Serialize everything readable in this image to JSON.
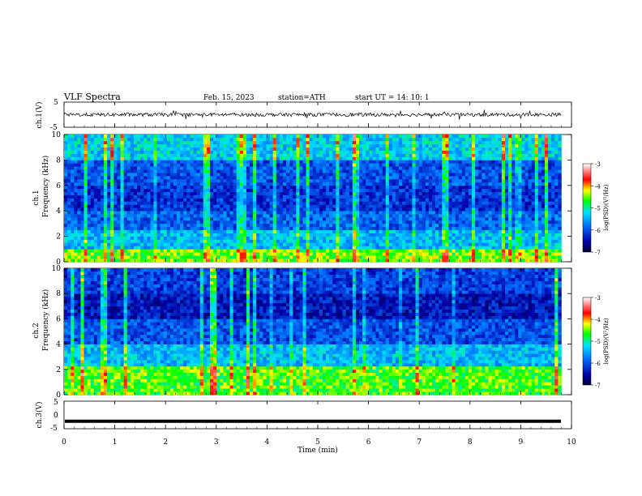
{
  "header": {
    "title": "VLF  Spectra",
    "date": "Feb. 15, 2023",
    "station": "station=ATH",
    "start": "start  UT  =    14: 10: 1"
  },
  "colors": {
    "background": "#ffffff",
    "axis": "#000000",
    "spectrogram_low": "#00007f",
    "spectrogram_mid": "#1e78ff",
    "spectrogram_high": "#00ff00",
    "spectrogram_peak": "#ff6600"
  },
  "chart_data": [
    {
      "type": "line",
      "name": "ch1-waveform",
      "ylabel": "ch.1(V)",
      "ylim": [
        -5,
        5
      ],
      "yticks": [
        "5",
        "-5"
      ],
      "xlim": [
        0,
        10
      ],
      "trace": "noisy waveform around 0 V with small excursions",
      "trace_level": 0
    },
    {
      "type": "heatmap",
      "name": "ch1-spectrogram",
      "title": "ch.1",
      "ylabel": "Frequency  (kHz)",
      "ylim": [
        0,
        10
      ],
      "yticks": [
        "0",
        "2",
        "4",
        "6",
        "8",
        "10"
      ],
      "xlim": [
        0,
        9.8
      ],
      "color_scale": {
        "label": "log(PSD)(V²/Hz)",
        "range": [
          -7,
          -3
        ],
        "ticks": [
          "-3",
          "-4",
          "-5",
          "-6",
          "-7"
        ]
      },
      "bands_khz": [
        {
          "from": 0,
          "to": 1.0,
          "level": -4.5
        },
        {
          "from": 1.0,
          "to": 2.4,
          "level": -5.4
        },
        {
          "from": 2.4,
          "to": 4.0,
          "level": -5.9
        },
        {
          "from": 4.0,
          "to": 6.0,
          "level": -6.2
        },
        {
          "from": 6.0,
          "to": 8.0,
          "level": -6.0
        },
        {
          "from": 8.0,
          "to": 10.0,
          "level": -5.3
        }
      ],
      "impulse_density": "high"
    },
    {
      "type": "heatmap",
      "name": "ch2-spectrogram",
      "title": "ch.2",
      "ylabel": "Frequency  (kHz)",
      "ylim": [
        0,
        10
      ],
      "yticks": [
        "0",
        "2",
        "4",
        "6",
        "8",
        "10"
      ],
      "xlim": [
        0,
        9.8
      ],
      "color_scale": {
        "label": "log(PSD)(V²/Hz)",
        "range": [
          -7,
          -3
        ],
        "ticks": [
          "-3",
          "-4",
          "-5",
          "-6",
          "-7"
        ]
      },
      "bands_khz": [
        {
          "from": 0,
          "to": 2.2,
          "level": -4.6
        },
        {
          "from": 2.2,
          "to": 4.0,
          "level": -5.4
        },
        {
          "from": 4.0,
          "to": 6.0,
          "level": -6.0
        },
        {
          "from": 6.0,
          "to": 8.0,
          "level": -6.4
        },
        {
          "from": 8.0,
          "to": 10.0,
          "level": -6.1
        }
      ],
      "impulse_density": "medium"
    },
    {
      "type": "line",
      "name": "ch3-waveform",
      "ylabel": "ch.3(V)",
      "ylim": [
        -5,
        5
      ],
      "yticks": [
        "5",
        "0",
        "-5"
      ],
      "xlim": [
        0,
        10
      ],
      "trace": "flat thick line",
      "trace_level": -2.3
    }
  ],
  "x_axis": {
    "label": "Time  (min)",
    "range": [
      0,
      10
    ],
    "ticks": [
      "0",
      "1",
      "2",
      "3",
      "4",
      "5",
      "6",
      "7",
      "8",
      "9",
      "10"
    ]
  }
}
